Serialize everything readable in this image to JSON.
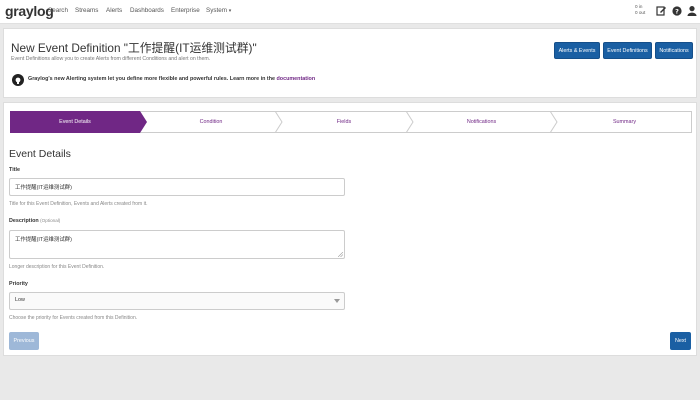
{
  "nav": {
    "logo": "graylog",
    "items": [
      "Search",
      "Streams",
      "Alerts",
      "Dashboards",
      "Enterprise",
      "System"
    ],
    "throughput_in": "0 in",
    "throughput_out": "0 out",
    "icons": [
      "edit-icon",
      "help-icon",
      "user-icon"
    ]
  },
  "header": {
    "title": "New Event Definition \"工作提醒(IT运维测试群)\"",
    "description": "Event Definitions allow you to create Alerts from different Conditions and alert on them.",
    "hint_text": "Graylog's new Alerting system let you define more flexible and powerful rules. Learn more in the ",
    "hint_link": "documentation",
    "buttons": [
      "Alerts & Events",
      "Event Definitions",
      "Notifications"
    ]
  },
  "wizard": {
    "steps": [
      "Event Details",
      "Condition",
      "Fields",
      "Notifications",
      "Summary"
    ],
    "active_index": 0,
    "accent_color": "#702785"
  },
  "form": {
    "section_title": "Event Details",
    "title_label": "Title",
    "title_value": "工作提醒(IT运维测试群)",
    "title_help": "Title for this Event Definition, Events and Alerts created from it.",
    "description_label": "Description",
    "description_optional": "(Optional)",
    "description_value": "工作提醒(IT运维测试群)",
    "description_help": "Longer description for this Event Definition.",
    "priority_label": "Priority",
    "priority_value": "Low",
    "priority_help": "Choose the priority for Events created from this Definition.",
    "previous_label": "Previous",
    "next_label": "Next"
  }
}
